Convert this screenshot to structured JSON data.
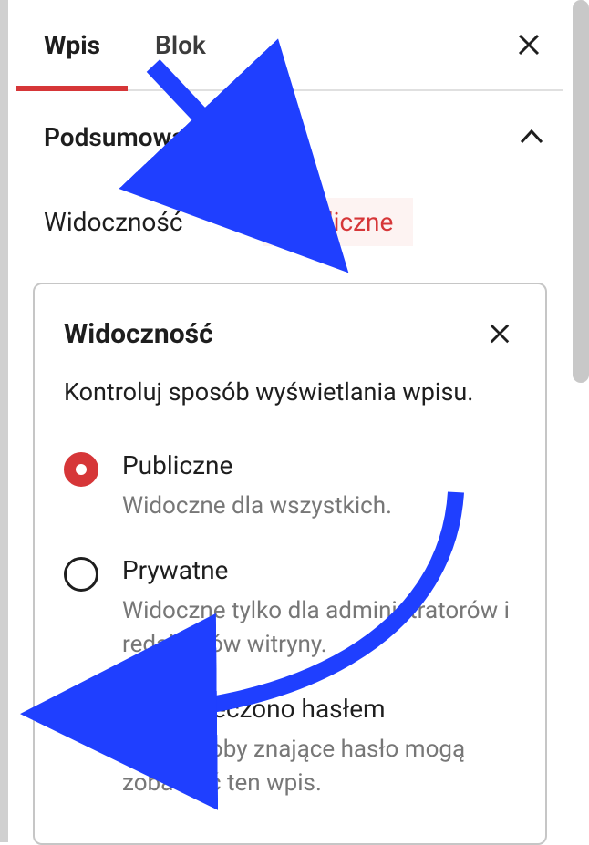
{
  "tabs": {
    "post": "Wpis",
    "block": "Blok"
  },
  "summary": {
    "title": "Podsumowanie",
    "visibility_label": "Widoczność",
    "visibility_value": "Publiczne"
  },
  "popover": {
    "title": "Widoczność",
    "description": "Kontroluj sposób wyświetlania wpisu.",
    "options": [
      {
        "label": "Publiczne",
        "description": "Widoczne dla wszystkich.",
        "checked": true
      },
      {
        "label": "Prywatne",
        "description": "Widoczne tylko dla administratorów i redaktorów witryny.",
        "checked": false
      },
      {
        "label": "Zabezpieczono hasłem",
        "description": "Tylko osoby znające hasło mogą zobaczyć ten wpis.",
        "checked": false
      }
    ]
  },
  "colors": {
    "accent": "#d63638",
    "annotation": "#1f3fff"
  }
}
